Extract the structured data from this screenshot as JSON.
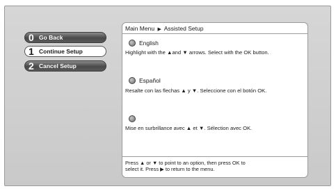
{
  "menu": {
    "items": [
      {
        "number": "0",
        "label": "Go Back"
      },
      {
        "number": "1",
        "label": "Continue Setup"
      },
      {
        "number": "2",
        "label": "Cancel Setup"
      }
    ]
  },
  "breadcrumb": {
    "parent": "Main Menu",
    "separator": "▶",
    "current": "Assisted Setup"
  },
  "options": [
    {
      "label": "English",
      "instruction": "Highlight with the ▲and ▼ arrows. Select with the OK button."
    },
    {
      "label": "Español",
      "instruction": "Resalte con las flechas ▲ y ▼. Seleccione con el botón OK."
    },
    {
      "label": "",
      "instruction": "Mise en surbrillance avec ▲ et ▼. Sélection avec OK."
    }
  ],
  "footer": {
    "line1": "Press ▲ or ▼ to point to an option, then press OK to",
    "line2": "select it. Press ▶ to return to the menu."
  }
}
